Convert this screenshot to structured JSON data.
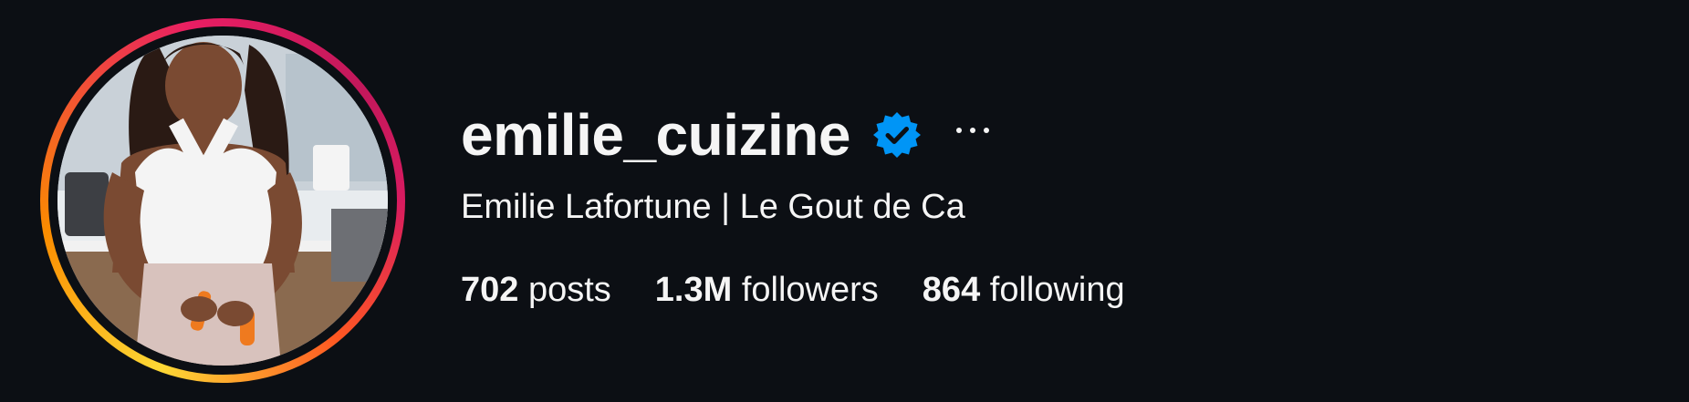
{
  "profile": {
    "username": "emilie_cuizine",
    "full_name": "Emilie Lafortune | Le Gout de Ca",
    "verified": true,
    "avatar_description": "profile-photo",
    "stats": [
      {
        "value": "702",
        "label": "posts"
      },
      {
        "value": "1.3M",
        "label": "followers"
      },
      {
        "value": "864",
        "label": "following"
      }
    ]
  },
  "colors": {
    "background": "#0c0f14",
    "text": "#f5f5f5",
    "verified_badge": "#0095f6"
  },
  "icons": {
    "verified": "verified-badge-icon",
    "more": "more-options-icon"
  }
}
